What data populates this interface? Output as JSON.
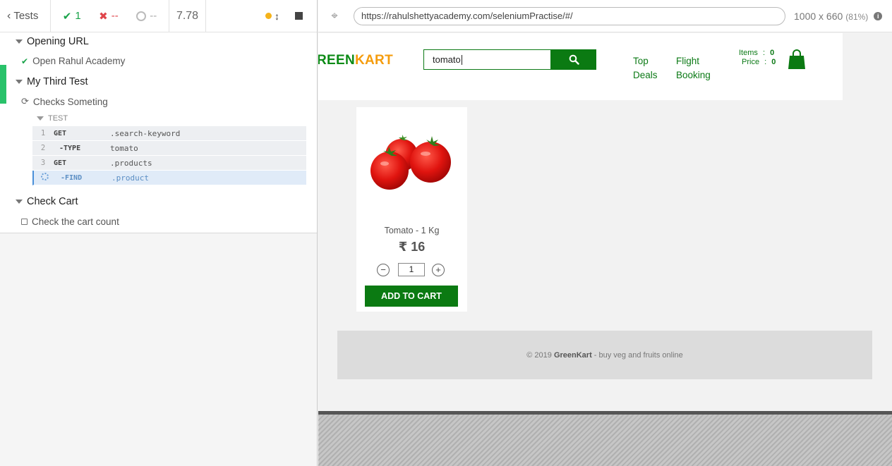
{
  "reporter": {
    "back_label": "Tests",
    "passed": "1",
    "failed": "--",
    "pending": "--",
    "duration": "7.78",
    "suites": [
      {
        "title": "Opening URL",
        "tests": [
          {
            "title": "Open Rahul Academy",
            "state": "passed"
          }
        ]
      },
      {
        "title": "My Third Test",
        "tests": [
          {
            "title": "Checks Someting",
            "state": "running"
          }
        ]
      },
      {
        "title": "Check Cart",
        "tests": [
          {
            "title": "Check the cart count",
            "state": "pending"
          }
        ]
      }
    ],
    "command_group": "TEST",
    "commands": [
      {
        "num": "1",
        "name": "GET",
        "value": ".search-keyword"
      },
      {
        "num": "2",
        "name": "-TYPE",
        "value": "tomato"
      },
      {
        "num": "3",
        "name": "GET",
        "value": ".products"
      },
      {
        "num": "",
        "name": "-FIND",
        "value": ".product"
      }
    ]
  },
  "browser": {
    "url": "https://rahulshettyacademy.com/seleniumPractise/#/",
    "viewport": "1000 x 660",
    "scale": "(81%)"
  },
  "site": {
    "logo_green": "REEN",
    "logo_kart": "KART",
    "search_value": "tomato",
    "nav": [
      {
        "line1": "Top",
        "line2": "Deals"
      },
      {
        "line1": "Flight",
        "line2": "Booking"
      }
    ],
    "items_label": "Items",
    "items_value": "0",
    "price_label": "Price",
    "price_value": "0",
    "product": {
      "name": "Tomato - 1 Kg",
      "price": "₹ 16",
      "quantity": "1",
      "add_label": "ADD TO CART"
    },
    "footer_prefix": "© 2019 ",
    "footer_brand": "GreenKart",
    "footer_suffix": " - buy veg and fruits online"
  },
  "colors": {
    "brand_green": "#0b7a12",
    "brand_orange": "#f59c0d",
    "pass": "#1aa34a",
    "fail": "#e0454b"
  }
}
